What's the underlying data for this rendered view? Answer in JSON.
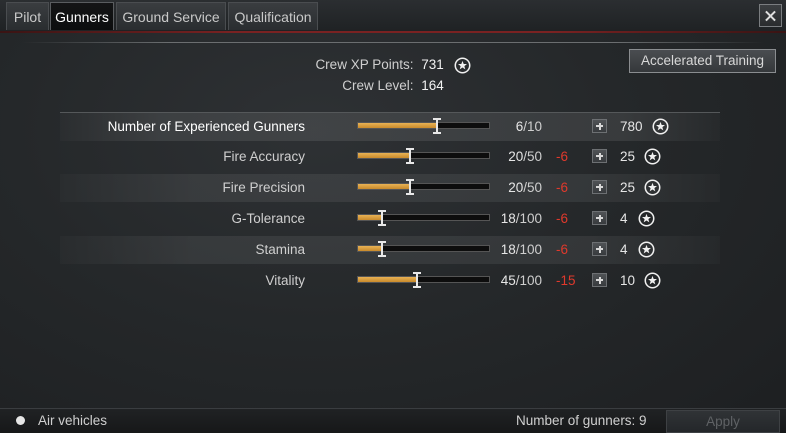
{
  "tabs": [
    {
      "label": "Pilot",
      "active": false
    },
    {
      "label": "Gunners",
      "active": true
    },
    {
      "label": "Ground Service",
      "active": false
    },
    {
      "label": "Qualification",
      "active": false
    }
  ],
  "header": {
    "xp_label": "Crew XP Points:",
    "xp_value": "731",
    "level_label": "Crew Level:",
    "level_value": "164",
    "accelerated_training_label": "Accelerated Training"
  },
  "skills": [
    {
      "name": "Number of Experienced Gunners",
      "value": "6",
      "max": "/10",
      "delta": "",
      "cost": "780",
      "fill": 0.6
    },
    {
      "name": "Fire Accuracy",
      "value": "20",
      "max": "/50",
      "delta": "-6",
      "cost": "25",
      "fill": 0.4
    },
    {
      "name": "Fire Precision",
      "value": "20",
      "max": "/50",
      "delta": "-6",
      "cost": "25",
      "fill": 0.4
    },
    {
      "name": "G-Tolerance",
      "value": "18",
      "max": "/100",
      "delta": "-6",
      "cost": "4",
      "fill": 0.18
    },
    {
      "name": "Stamina",
      "value": "18",
      "max": "/100",
      "delta": "-6",
      "cost": "4",
      "fill": 0.18
    },
    {
      "name": "Vitality",
      "value": "45",
      "max": "/100",
      "delta": "-15",
      "cost": "10",
      "fill": 0.45
    }
  ],
  "footer": {
    "vehicle_type_label": "Air vehicles",
    "gunners_count_label": "Number of gunners: 9",
    "apply_label": "Apply"
  },
  "icons": {
    "close": "close-icon",
    "star": "star-icon",
    "plus": "plus-icon",
    "radio": "radio-dot-icon"
  },
  "colors": {
    "accent_bar": "#d99a3a",
    "delta_red": "#e0392c",
    "tab_divider_red": "#7a2222"
  }
}
